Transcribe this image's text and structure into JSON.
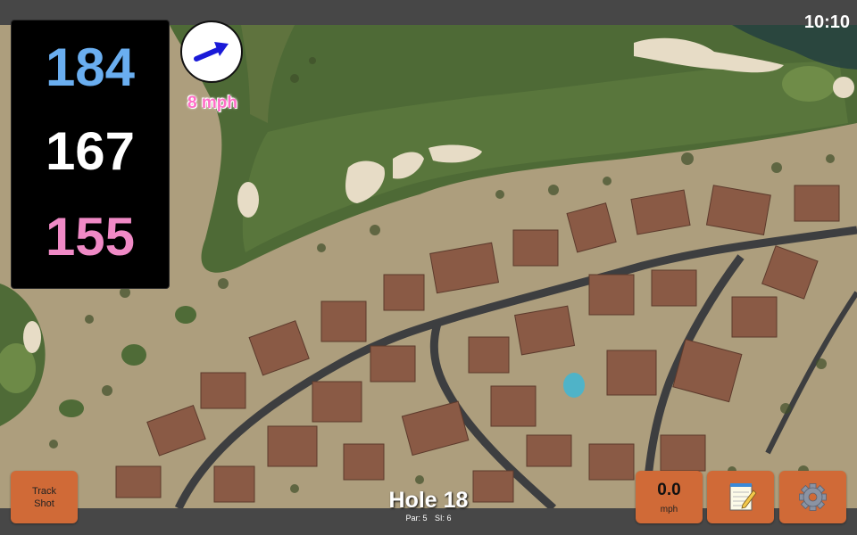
{
  "status": {
    "time": "10:10"
  },
  "yardage": {
    "back": "184",
    "center": "167",
    "front": "155"
  },
  "wind": {
    "speed_label": "8 mph",
    "direction_icon": "arrow-icon"
  },
  "hole": {
    "title": "Hole 18",
    "par": "Par: 5",
    "si": "SI: 6"
  },
  "buttons": {
    "track_shot": {
      "line1": "Track",
      "line2": "Shot"
    },
    "wind_speed": {
      "value": "0.0",
      "unit": "mph"
    },
    "notes": {
      "icon": "notepad-icon"
    },
    "settings": {
      "icon": "gear-icon"
    }
  },
  "colors": {
    "back_yardage": "#6aaef0",
    "center_yardage": "#ffffff",
    "front_yardage": "#f08ac6",
    "button": "#d06a37",
    "wind_label": "#ff6fc8"
  }
}
